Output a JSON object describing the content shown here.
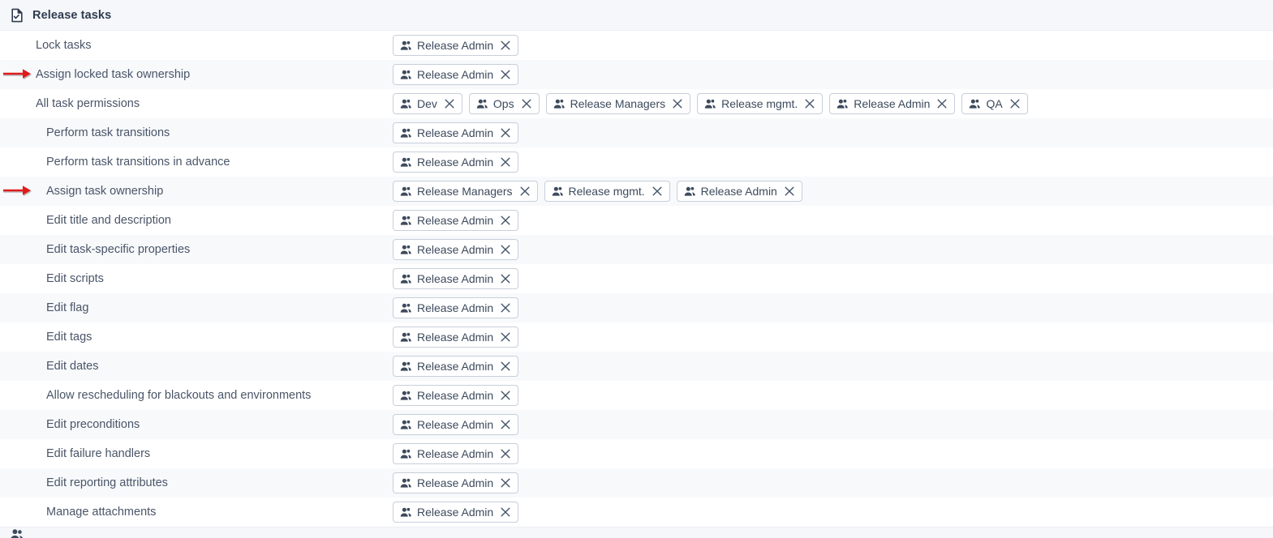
{
  "section": {
    "title": "Release tasks",
    "icon": "document-check-icon"
  },
  "icons": {
    "people": "people-icon",
    "remove": "close-icon",
    "arrow": "red-arrow-annotation-icon"
  },
  "colors": {
    "row_bg": "#ffffff",
    "row_bg_alt": "#f7f9fb",
    "header_bg": "#f5f7fa",
    "text": "#4a5568",
    "chip_border": "#c7cfda",
    "chip_text": "#3d4a5c",
    "annotation": "#e01b1b"
  },
  "rows": [
    {
      "label": "Lock tasks",
      "level": 0,
      "annotated": false,
      "tags": [
        "Release Admin"
      ]
    },
    {
      "label": "Assign locked task ownership",
      "level": 0,
      "annotated": true,
      "tags": [
        "Release Admin"
      ]
    },
    {
      "label": "All task permissions",
      "level": 0,
      "annotated": false,
      "tags": [
        "Dev",
        "Ops",
        "Release Managers",
        "Release mgmt.",
        "Release Admin",
        "QA"
      ]
    },
    {
      "label": "Perform task transitions",
      "level": 1,
      "annotated": false,
      "tags": [
        "Release Admin"
      ]
    },
    {
      "label": "Perform task transitions in advance",
      "level": 1,
      "annotated": false,
      "tags": [
        "Release Admin"
      ]
    },
    {
      "label": "Assign task ownership",
      "level": 1,
      "annotated": true,
      "tags": [
        "Release Managers",
        "Release mgmt.",
        "Release Admin"
      ]
    },
    {
      "label": "Edit title and description",
      "level": 1,
      "annotated": false,
      "tags": [
        "Release Admin"
      ]
    },
    {
      "label": "Edit task-specific properties",
      "level": 1,
      "annotated": false,
      "tags": [
        "Release Admin"
      ]
    },
    {
      "label": "Edit scripts",
      "level": 1,
      "annotated": false,
      "tags": [
        "Release Admin"
      ]
    },
    {
      "label": "Edit flag",
      "level": 1,
      "annotated": false,
      "tags": [
        "Release Admin"
      ]
    },
    {
      "label": "Edit tags",
      "level": 1,
      "annotated": false,
      "tags": [
        "Release Admin"
      ]
    },
    {
      "label": "Edit dates",
      "level": 1,
      "annotated": false,
      "tags": [
        "Release Admin"
      ]
    },
    {
      "label": "Allow rescheduling for blackouts and environments",
      "level": 1,
      "annotated": false,
      "tags": [
        "Release Admin"
      ]
    },
    {
      "label": "Edit preconditions",
      "level": 1,
      "annotated": false,
      "tags": [
        "Release Admin"
      ]
    },
    {
      "label": "Edit failure handlers",
      "level": 1,
      "annotated": false,
      "tags": [
        "Release Admin"
      ]
    },
    {
      "label": "Edit reporting attributes",
      "level": 1,
      "annotated": false,
      "tags": [
        "Release Admin"
      ]
    },
    {
      "label": "Manage attachments",
      "level": 1,
      "annotated": false,
      "tags": [
        "Release Admin"
      ]
    }
  ]
}
